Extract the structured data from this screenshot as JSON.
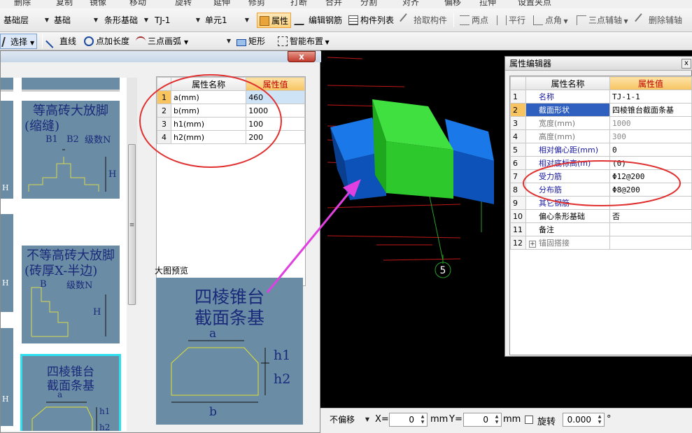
{
  "toolbar_top": {
    "items": [
      "删除",
      "复制",
      "镜像",
      "移动",
      "旋转",
      "延伸",
      "修剪",
      "打断",
      "合并",
      "分割",
      "对齐",
      "偏移",
      "拉伸",
      "设置夹点"
    ]
  },
  "toolbar1": {
    "floor": "基础层",
    "category": "基础",
    "element_type": "条形基础",
    "element": "TJ-1",
    "unit": "单元1",
    "attr_button": "属性",
    "edit_rebar": "编辑钢筋",
    "component_list": "构件列表",
    "pick_component": "拾取构件",
    "two_points": "两点",
    "parallel": "平行",
    "point_angle": "点角",
    "three_point_aux": "三点辅轴",
    "delete_aux": "删除辅轴"
  },
  "toolbar2": {
    "select": "选择",
    "line": "直线",
    "point_length": "点加长度",
    "arc": "三点画弧",
    "rect": "矩形",
    "smart_layout": "智能布置"
  },
  "dialog": {
    "close_label": "x",
    "tiles": [
      {
        "title1": "等高砖大放脚",
        "title2": "(缩缝)",
        "l1": "B1",
        "l2": "B2",
        "l3": "级数N",
        "l4": "H"
      },
      {
        "title1": "不等高砖大放脚",
        "title2": "(砖厚X-半边)",
        "l1": "B",
        "l2": "级数N",
        "l3": "H"
      },
      {
        "title1": "四棱锥台",
        "title2": "截面条基",
        "l1": "a",
        "l2": "h1",
        "l3": "h2",
        "l4": "b"
      }
    ],
    "partial_labels": [
      "H",
      "H",
      "H"
    ],
    "scroll_glyph": "≡",
    "param_table": {
      "headers": [
        "属性名称",
        "属性值"
      ],
      "rows": [
        {
          "no": "1",
          "name": "a(mm)",
          "value": "460"
        },
        {
          "no": "2",
          "name": "b(mm)",
          "value": "1000"
        },
        {
          "no": "3",
          "name": "h1(mm)",
          "value": "100"
        },
        {
          "no": "4",
          "name": "h2(mm)",
          "value": "200"
        }
      ]
    },
    "preview_label": "大图预览",
    "preview": {
      "title1": "四棱锥台",
      "title2": "截面条基",
      "a": "a",
      "h1": "h1",
      "h2": "h2",
      "b": "b"
    }
  },
  "viewport": {
    "axis_label": "5"
  },
  "property_editor": {
    "title": "属性编辑器",
    "close_label": "x",
    "headers": [
      "属性名称",
      "属性值"
    ],
    "rows": [
      {
        "no": "1",
        "name": "名称",
        "value": "TJ-1-1",
        "style": "blue"
      },
      {
        "no": "2",
        "name": "截面形状",
        "value": "四棱锥台截面条基",
        "style": "blue"
      },
      {
        "no": "3",
        "name": "宽度(mm)",
        "value": "1000",
        "style": "gray"
      },
      {
        "no": "4",
        "name": "高度(mm)",
        "value": "300",
        "style": "gray"
      },
      {
        "no": "5",
        "name": "相对偏心距(mm)",
        "value": "0",
        "style": "blue"
      },
      {
        "no": "6",
        "name": "相对底标高(m)",
        "value": "(0)",
        "style": "blue"
      },
      {
        "no": "7",
        "name": "受力筋",
        "value": "Φ12@200",
        "style": "blue"
      },
      {
        "no": "8",
        "name": "分布筋",
        "value": "Φ8@200",
        "style": "blue"
      },
      {
        "no": "9",
        "name": "其它钢筋",
        "value": "",
        "style": "blue"
      },
      {
        "no": "10",
        "name": "偏心条形基础",
        "value": "否",
        "style": "black"
      },
      {
        "no": "11",
        "name": "备注",
        "value": "",
        "style": "black"
      },
      {
        "no": "12",
        "name": "锚固搭接",
        "value": "",
        "style": "gray"
      }
    ]
  },
  "status_bar": {
    "mode": "不偏移",
    "x_label": "X=",
    "x_value": "0",
    "x_unit": "mm",
    "y_label": "Y=",
    "y_value": "0",
    "y_unit": "mm",
    "rotate_label": "旋转",
    "rotate_value": "0.000",
    "rotate_unit": "°"
  },
  "colors": {
    "annotation": "#e03030",
    "arrow": "#e040e0",
    "solid_green": "#3ad23a",
    "solid_blue": "#1a6fd8",
    "tile_bg": "#6a8ca5"
  }
}
